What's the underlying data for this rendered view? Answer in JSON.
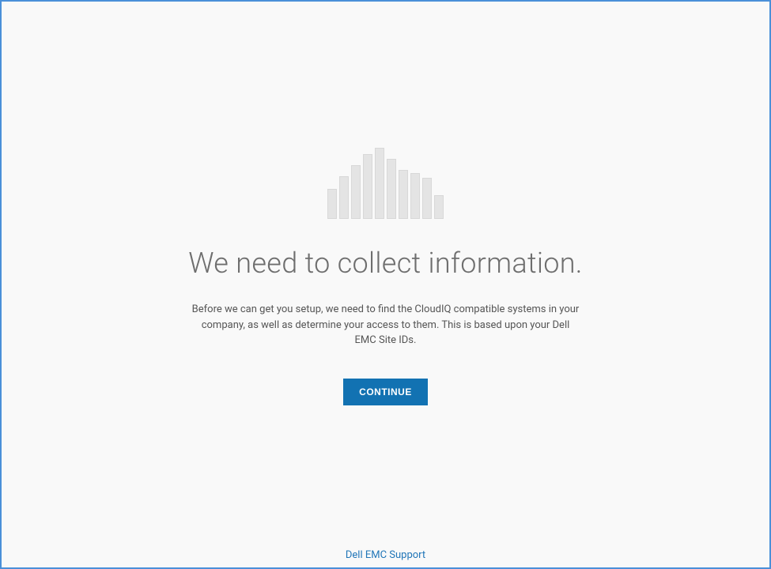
{
  "main": {
    "heading": "We need to collect information.",
    "description": "Before we can get you setup, we need to find the CloudIQ compatible systems in your company, as well as determine your access to them. This is based upon your Dell EMC Site IDs.",
    "continue_label": "CONTINUE"
  },
  "footer": {
    "support_link": "Dell EMC Support"
  }
}
